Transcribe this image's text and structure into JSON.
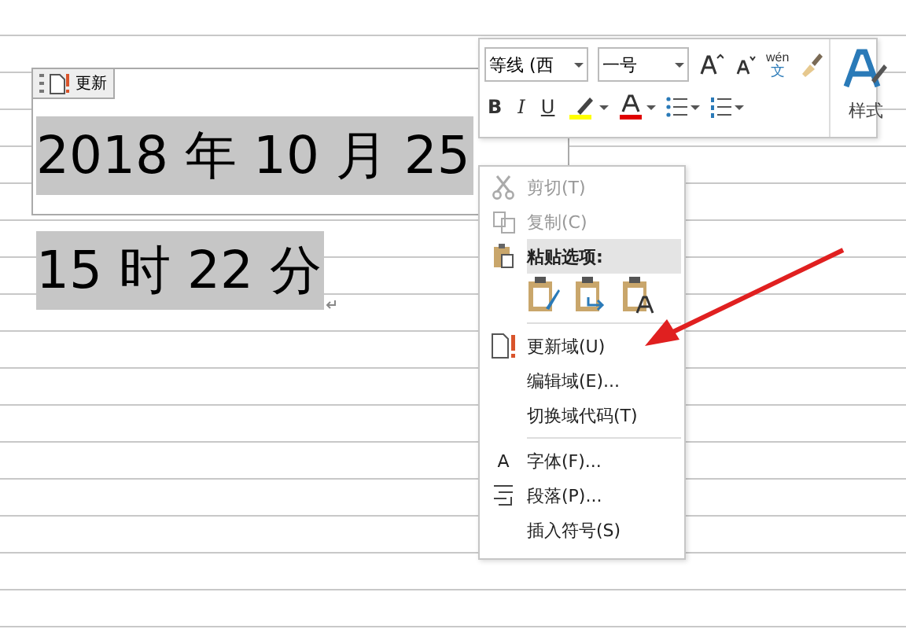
{
  "document": {
    "field_tab": {
      "label": "更新"
    },
    "lines": [
      "2018 年 10 月 25",
      "15 时 22 分"
    ]
  },
  "mini_toolbar": {
    "font": "等线 (西",
    "size": "一号",
    "phonetic_top": "wén",
    "phonetic_bottom": "文",
    "bold": "B",
    "italic": "I",
    "underline": "U",
    "styles_label": "样式"
  },
  "context_menu": {
    "items": [
      {
        "kind": "item",
        "label": "剪切(T)",
        "disabled": true
      },
      {
        "kind": "item",
        "label": "复制(C)",
        "disabled": true
      },
      {
        "kind": "header",
        "label": "粘贴选项:"
      },
      {
        "kind": "paste_row"
      },
      {
        "kind": "separator"
      },
      {
        "kind": "item",
        "label": "更新域(U)",
        "disabled": false
      },
      {
        "kind": "item",
        "label": "编辑域(E)...",
        "disabled": false
      },
      {
        "kind": "item",
        "label": "切换域代码(T)",
        "disabled": false
      },
      {
        "kind": "separator"
      },
      {
        "kind": "item",
        "glyph": "A",
        "label": "字体(F)...",
        "disabled": false
      },
      {
        "kind": "item",
        "label": "段落(P)...",
        "disabled": false
      },
      {
        "kind": "item",
        "label": "插入符号(S)",
        "disabled": false
      }
    ]
  }
}
